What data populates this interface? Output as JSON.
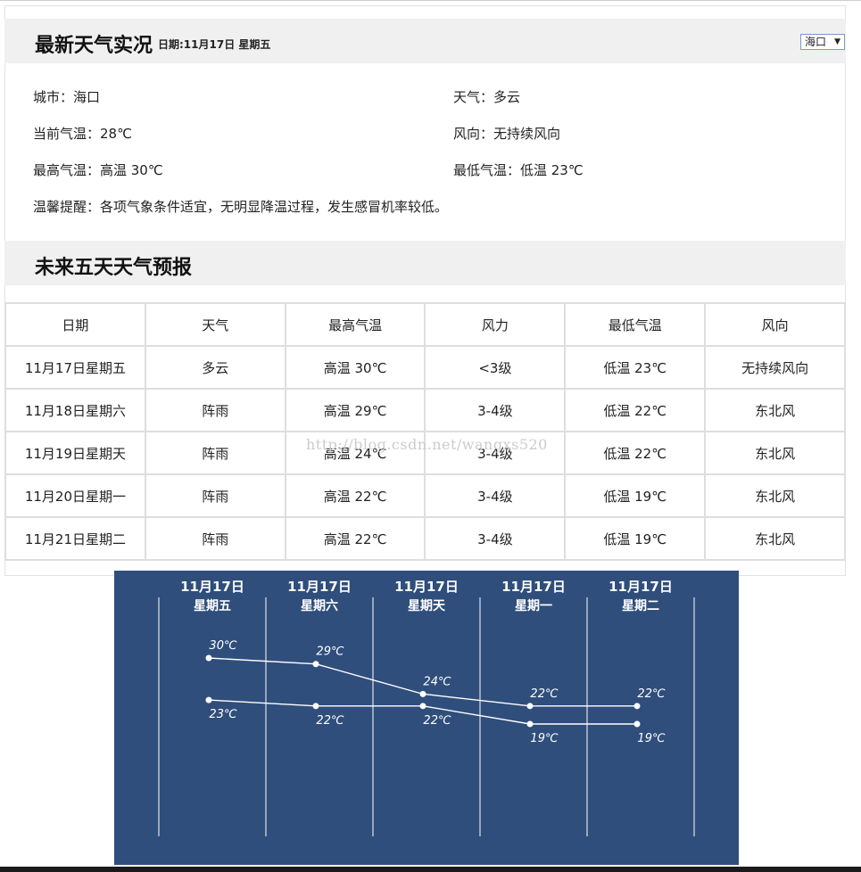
{
  "current": {
    "title": "最新天气实况",
    "date": "日期:11月17日 星期五",
    "city_select": "海口",
    "city": "城市：海口",
    "weather": "天气：多云",
    "temp": "当前气温：28℃",
    "wind_dir": "风向：无持续风向",
    "high": "最高气温：高温 30℃",
    "low": "最低气温：低温 23℃",
    "tip": "温馨提醒：各项气象条件适宜，无明显降温过程，发生感冒机率较低。"
  },
  "forecast": {
    "title": "未来五天天气预报",
    "headers": [
      "日期",
      "天气",
      "最高气温",
      "风力",
      "最低气温",
      "风向"
    ],
    "rows": [
      [
        "11月17日星期五",
        "多云",
        "高温 30℃",
        "<3级",
        "低温 23℃",
        "无持续风向"
      ],
      [
        "11月18日星期六",
        "阵雨",
        "高温 29℃",
        "3-4级",
        "低温 22℃",
        "东北风"
      ],
      [
        "11月19日星期天",
        "阵雨",
        "高温 24℃",
        "3-4级",
        "低温 22℃",
        "东北风"
      ],
      [
        "11月20日星期一",
        "阵雨",
        "高温 22℃",
        "3-4级",
        "低温 19℃",
        "东北风"
      ],
      [
        "11月21日星期二",
        "阵雨",
        "高温 22℃",
        "3-4级",
        "低温 19℃",
        "东北风"
      ]
    ]
  },
  "watermark": "http://blog.csdn.net/wangxs520",
  "colors": {
    "chart_bg": "#2f4e7b",
    "line": "#ffffff",
    "header_bg": "#f0f0f0"
  },
  "chart_data": {
    "type": "line",
    "categories": [
      {
        "date": "11月17日",
        "day": "星期五"
      },
      {
        "date": "11月17日",
        "day": "星期六"
      },
      {
        "date": "11月17日",
        "day": "星期天"
      },
      {
        "date": "11月17日",
        "day": "星期一"
      },
      {
        "date": "11月17日",
        "day": "星期二"
      }
    ],
    "series": [
      {
        "values": [
          30,
          29,
          24,
          22,
          22
        ],
        "labels": [
          "30℃",
          "29℃",
          "24℃",
          "22℃",
          "22℃"
        ]
      },
      {
        "values": [
          23,
          22,
          22,
          19,
          19
        ],
        "labels": [
          "23℃",
          "22℃",
          "22℃",
          "19℃",
          "19℃"
        ]
      }
    ],
    "grid": true
  }
}
